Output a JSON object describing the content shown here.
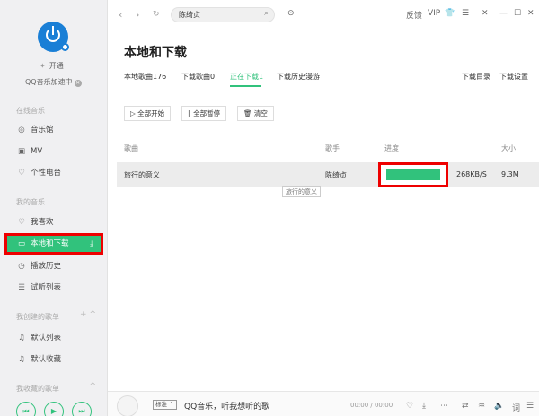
{
  "sidebar": {
    "open_vip": "开通",
    "speedup": "QQ音乐加速中",
    "sections": {
      "online": "在线音乐",
      "my_music": "我的音乐",
      "created": "我创建的歌单",
      "collected": "我收藏的歌单"
    },
    "online_items": [
      {
        "label": "音乐馆",
        "icon": "music-hall-icon"
      },
      {
        "label": "MV",
        "icon": "mv-icon"
      },
      {
        "label": "个性电台",
        "icon": "radio-icon"
      }
    ],
    "my_items": [
      {
        "label": "我喜欢",
        "icon": "heart-icon"
      },
      {
        "label": "本地和下载",
        "icon": "monitor-icon",
        "active": true
      },
      {
        "label": "播放历史",
        "icon": "history-icon"
      },
      {
        "label": "试听列表",
        "icon": "playlist-icon"
      }
    ],
    "created_items": [
      {
        "label": "默认列表",
        "icon": "note-icon"
      },
      {
        "label": "默认收藏",
        "icon": "note-icon"
      }
    ]
  },
  "topbar": {
    "search_value": "陈绮贞",
    "right_items": [
      "反馈",
      "VIP"
    ]
  },
  "main": {
    "title": "本地和下载",
    "tabs": [
      "本地歌曲176",
      "下载歌曲0",
      "正在下载1",
      "下载历史漫游"
    ],
    "active_tab": 2,
    "right_links": [
      "下载目录",
      "下载设置"
    ],
    "buttons": [
      "全部开始",
      "全部暂停",
      "清空"
    ],
    "columns": [
      "歌曲",
      "歌手",
      "进度",
      "大小"
    ],
    "rows": [
      {
        "song": "旅行的意义",
        "artist": "陈绮贞",
        "progress": 1.0,
        "speed": "268KB/S",
        "size": "9.3M"
      }
    ],
    "tooltip": "旅行的意义"
  },
  "player": {
    "quality": "标准",
    "song": "QQ音乐，听我想听的歌",
    "time": "00:00 / 00:00"
  },
  "colors": {
    "accent": "#31c27c",
    "highlight": "#e00000",
    "logo": "#1a7fd6"
  }
}
